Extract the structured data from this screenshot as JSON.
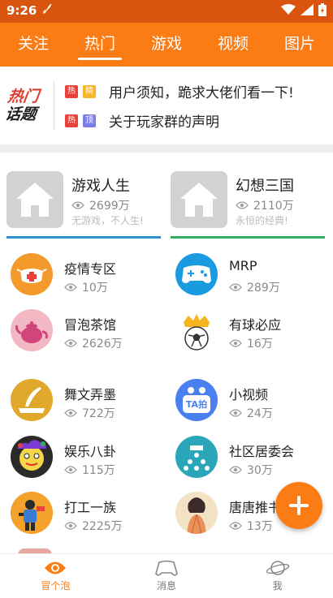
{
  "status_bar": {
    "time": "9:26"
  },
  "top_tabs": [
    {
      "label": "关注"
    },
    {
      "label": "热门",
      "active": true
    },
    {
      "label": "游戏"
    },
    {
      "label": "视频"
    },
    {
      "label": "图片"
    }
  ],
  "hot_topics": {
    "logo_line1": "热门",
    "logo_line2": "话题",
    "items": [
      {
        "badges": [
          "热",
          "精"
        ],
        "text": "用户须知，跪求大佬们看一下!"
      },
      {
        "badges": [
          "热",
          "顶"
        ],
        "text": "关于玩家群的声明"
      }
    ]
  },
  "featured": [
    {
      "name": "游戏人生",
      "views": "2699万",
      "desc": "无游戏，不人生!",
      "underline_color": "#2f8fd6"
    },
    {
      "name": "幻想三国",
      "views": "2110万",
      "desc": "永恒的经典!",
      "underline_color": "#2fae62"
    }
  ],
  "grid": [
    {
      "name": "疫情专区",
      "views": "10万",
      "icon": "mask-icon"
    },
    {
      "name": "MRP",
      "views": "289万",
      "icon": "gamepad-icon"
    },
    {
      "name": "冒泡茶馆",
      "views": "2626万",
      "icon": "teapot-icon"
    },
    {
      "name": "有球必应",
      "views": "16万",
      "icon": "soccer-crown-icon"
    },
    {
      "name": "舞文弄墨",
      "views": "722万",
      "icon": "quill-icon"
    },
    {
      "name": "小视频",
      "views": "24万",
      "icon": "ta-pai-icon"
    },
    {
      "name": "娱乐八卦",
      "views": "115万",
      "icon": "cartoon-face-icon"
    },
    {
      "name": "社区居委会",
      "views": "30万",
      "icon": "community-icon"
    },
    {
      "name": "打工一族",
      "views": "2225万",
      "icon": "worker-icon"
    },
    {
      "name": "唐唐推书",
      "views": "13万",
      "icon": "lady-illustration-icon"
    }
  ],
  "ta_badge_text": "TA拍",
  "bottom_nav": [
    {
      "label": "冒个泡",
      "icon": "eye-icon",
      "active": true
    },
    {
      "label": "消息",
      "icon": "gamepad-outline-icon"
    },
    {
      "label": "我",
      "icon": "planet-icon"
    }
  ],
  "colors": {
    "status_bar": "#d9550f",
    "brand_orange": "#fb7b14",
    "hot_badge": "#e8403b",
    "jing_badge": "#f7b42c",
    "ding_badge": "#7b7ee8"
  }
}
